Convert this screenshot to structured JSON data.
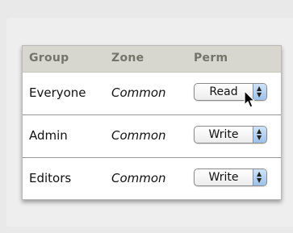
{
  "table": {
    "headers": {
      "group": "Group",
      "zone": "Zone",
      "perm": "Perm"
    },
    "rows": [
      {
        "group": "Everyone",
        "zone": "Common",
        "perm": "Read"
      },
      {
        "group": "Admin",
        "zone": "Common",
        "perm": "Write"
      },
      {
        "group": "Editors",
        "zone": "Common",
        "perm": "Write"
      }
    ]
  },
  "icons": {
    "popup_arrows": "up-down-stepper-icon",
    "cursor": "arrow-pointer-icon"
  },
  "colors": {
    "background": "#e9e9e9",
    "header_background": "#d7d7cf",
    "header_text": "#74746a",
    "popup_arrows": "#9cc1ea"
  }
}
